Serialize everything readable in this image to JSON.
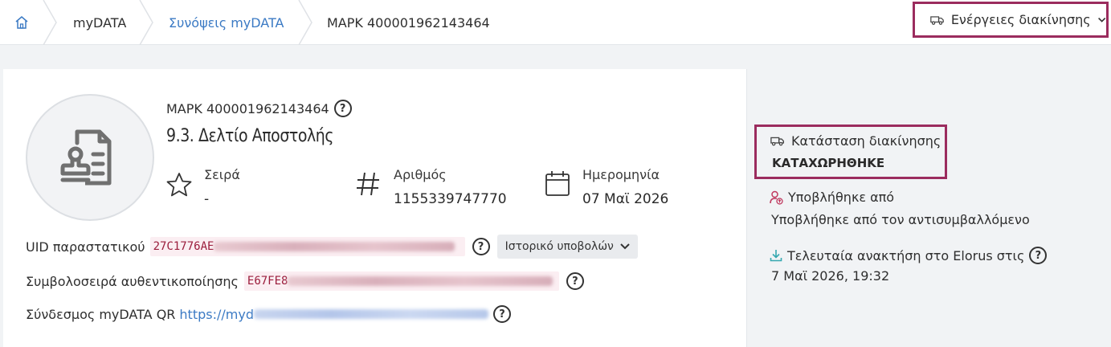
{
  "breadcrumb": {
    "home_icon": "home-icon",
    "items": [
      "myDATA",
      "Συνόψεις myDATA",
      "ΜΑΡΚ 400001962143464"
    ]
  },
  "actions": {
    "label": "Ενέργειες διακίνησης",
    "icon": "truck-icon"
  },
  "document": {
    "mark": "ΜΑΡΚ 400001962143464",
    "title": "9.3. Δελτίο Αποστολής",
    "series_label": "Σειρά",
    "series_value": "-",
    "number_label": "Αριθμός",
    "number_value": "1155339747770",
    "date_label": "Ημερομηνία",
    "date_value": "07 Μαϊ 2026"
  },
  "uid": {
    "label": "UID παραστατικού",
    "value": "27C1776AE"
  },
  "history_button": "Ιστορικό υποβολών",
  "auth": {
    "label": "Συμβολοσειρά αυθεντικοποίησης",
    "value": "E67FE8"
  },
  "qr": {
    "label": "Σύνδεσμος myDATA QR",
    "value": "https://myd"
  },
  "status": {
    "label": "Κατάσταση διακίνησης",
    "value": "ΚΑΤΑΧΩΡΗΘΗΚΕ"
  },
  "submitted": {
    "label": "Υποβλήθηκε από",
    "value": "Υποβλήθηκε από τον αντισυμβαλλόμενο"
  },
  "last_fetch": {
    "label": "Τελευταία ανακτήση στο Elorus στις",
    "value": "7 Μαϊ 2026, 19:32"
  },
  "colors": {
    "accent_border": "#9b2c5e",
    "link": "#3b7ac4",
    "code_text": "#9b1d3c"
  }
}
